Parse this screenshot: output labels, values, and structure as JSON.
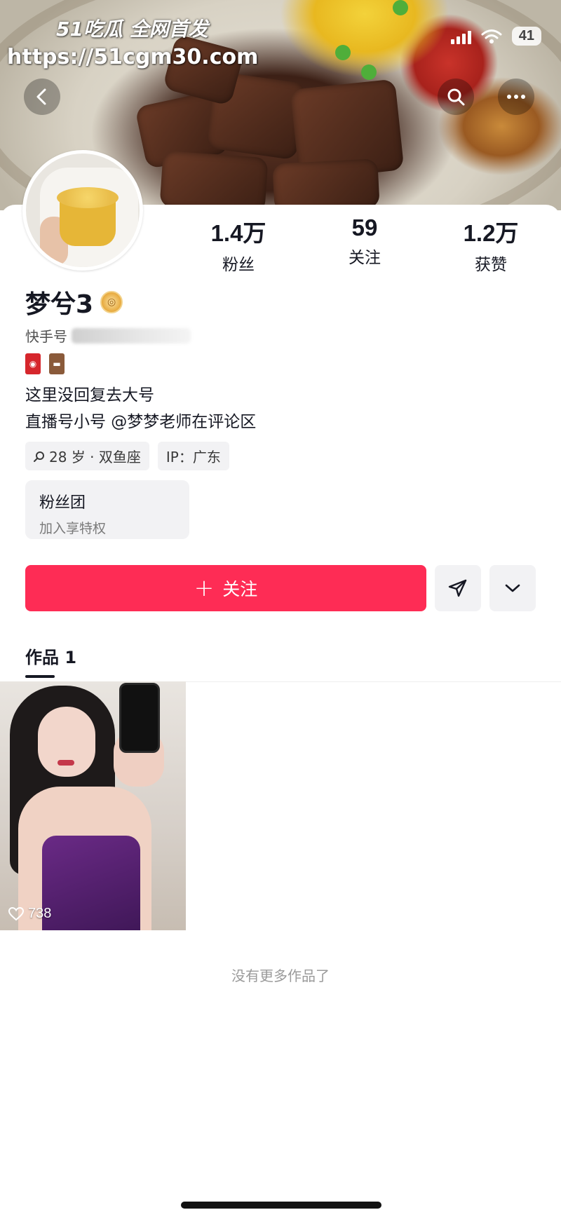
{
  "watermark": {
    "brand": "51吃瓜 全网首发",
    "url": "https://51cgm30.com"
  },
  "status_bar": {
    "battery": "41"
  },
  "header": {
    "back_icon": "chevron-left-icon",
    "search_icon": "search-icon",
    "more_icon": "more-icon"
  },
  "profile": {
    "name": "梦兮3",
    "id_label": "快手号",
    "bio_lines": [
      "这里没回复去大号",
      "直播号小号 @梦梦老师在评论区"
    ],
    "chips": {
      "age": "28 岁 · 双鱼座",
      "ip": "IP：广东"
    }
  },
  "stats": [
    {
      "value": "1.4万",
      "label": "粉丝"
    },
    {
      "value": "59",
      "label": "关注"
    },
    {
      "value": "1.2万",
      "label": "获赞"
    }
  ],
  "fan_club": {
    "title": "粉丝团",
    "subtitle": "加入享特权"
  },
  "actions": {
    "follow_plus": "+",
    "follow_label": "关注"
  },
  "works": {
    "tab_label": "作品 1",
    "items": [
      {
        "likes": "738"
      }
    ],
    "end_text": "没有更多作品了"
  },
  "colors": {
    "accent": "#fe2c55"
  }
}
